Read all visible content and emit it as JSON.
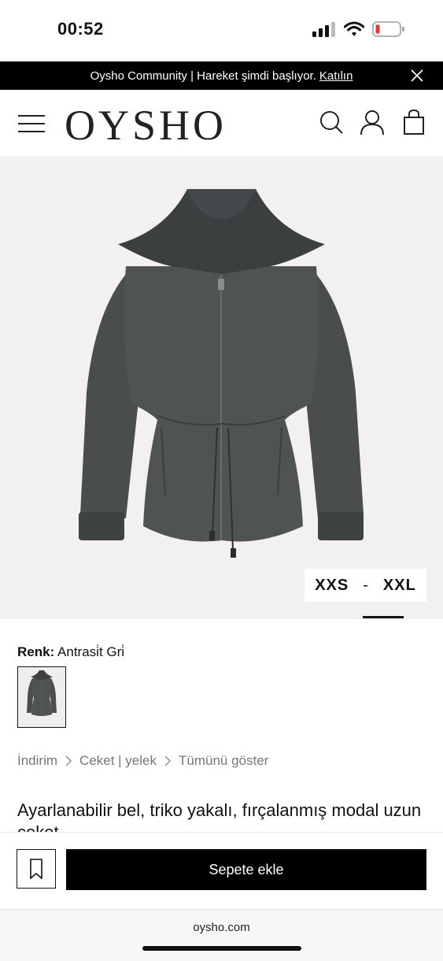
{
  "status_bar": {
    "time": "00:52"
  },
  "banner": {
    "text": "Oysho Community | Hareket şimdi başlıyor.",
    "link": "Katılın"
  },
  "header": {
    "logo": "OYSHO"
  },
  "product": {
    "size_min": "XXS",
    "size_sep": "-",
    "size_max": "XXL",
    "color_label": "Renk:",
    "color_value": "Antrasi̇t Gri̇",
    "breadcrumbs": [
      "İndirim",
      "Ceket | yelek",
      "Tümünü göster"
    ],
    "title": "Ayarlanabilir bel, triko yakalı, fırçalanmış modal uzun ceket"
  },
  "actions": {
    "add_to_cart": "Sepete ekle"
  },
  "browser": {
    "url": "oysho.com"
  },
  "colors": {
    "jacket": "#4a4d4e",
    "hero_bg": "#f3f1ef",
    "banner_bg": "#000000"
  }
}
